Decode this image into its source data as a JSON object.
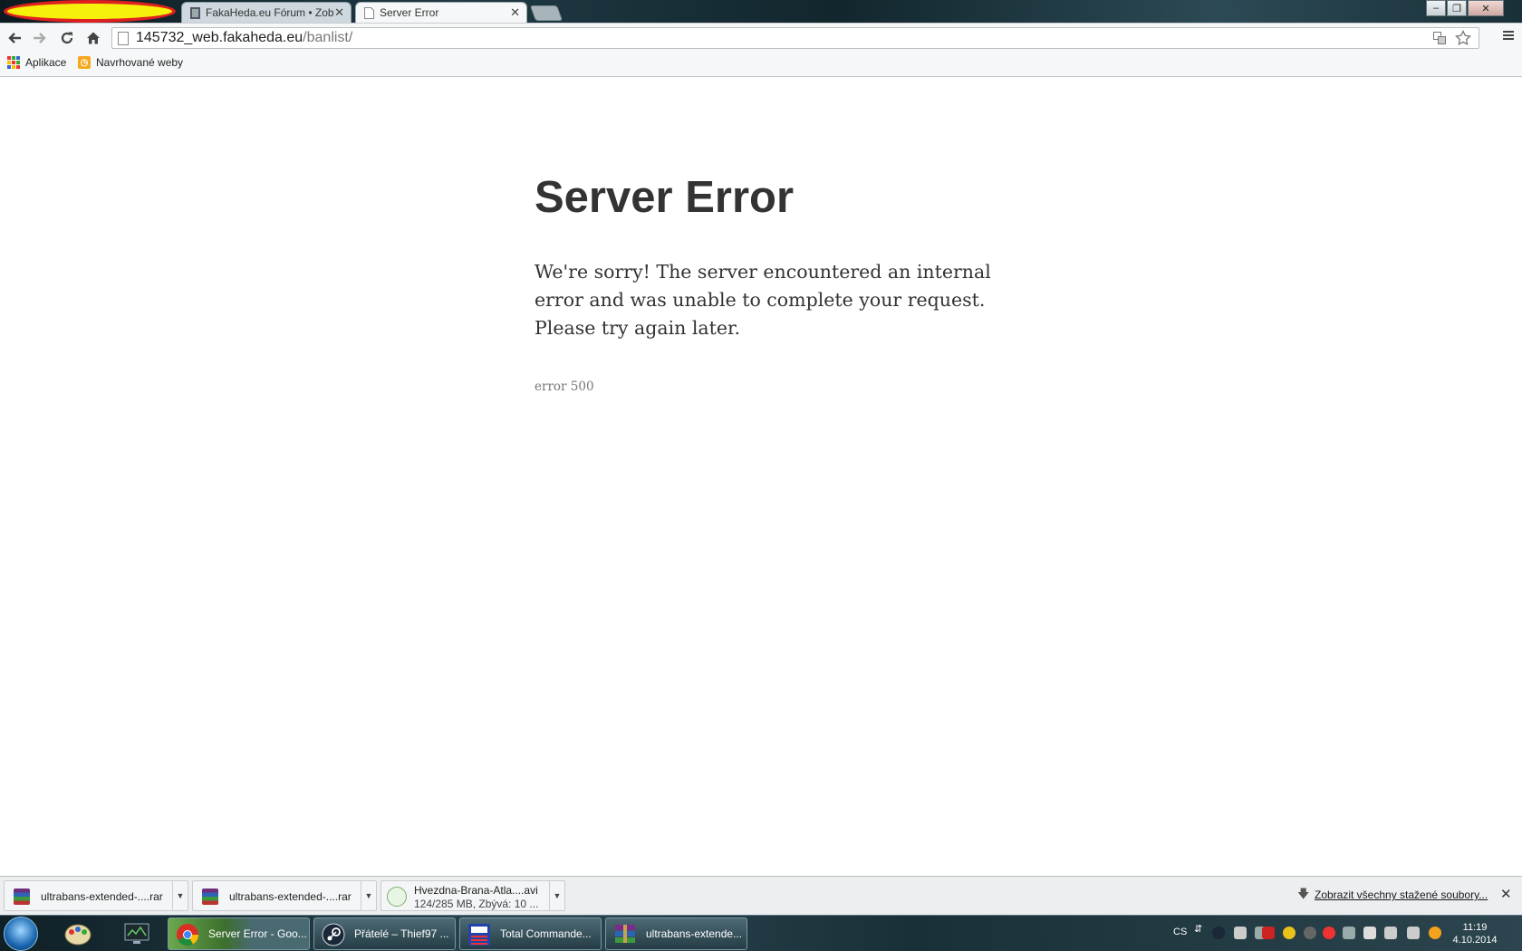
{
  "tabs": [
    {
      "title": "FakaHeda.eu Fórum • Zob",
      "active": false
    },
    {
      "title": "Server Error",
      "active": true
    }
  ],
  "window_controls": {
    "minimize": "‒",
    "restore": "❐",
    "close": "✕"
  },
  "address_bar": {
    "domain": "145732_web.fakaheda.eu",
    "path": "/banlist/"
  },
  "bookmarks": [
    {
      "label": "Aplikace",
      "icon": "apps-grid-icon"
    },
    {
      "label": "Navrhované weby",
      "icon": "suggested-sites-icon"
    }
  ],
  "page": {
    "title": "Server Error",
    "message": "We're sorry! The server encountered an internal error and was unable to complete your request. Please try again later.",
    "code": "error 500"
  },
  "downloads": {
    "items": [
      {
        "name": "ultrabans-extended-....rar"
      },
      {
        "name": "ultrabans-extended-....rar"
      },
      {
        "name": "Hvezdna-Brana-Atla....avi",
        "status": "124/285 MB, Zbývá: 10 ..."
      }
    ],
    "show_all": "Zobrazit všechny stažené soubory...",
    "close": "✕"
  },
  "taskbar": {
    "tasks": [
      {
        "label": "Server Error - Goo...",
        "icon": "chrome-icon",
        "active": true
      },
      {
        "label": "Přátelé – Thief97 ...",
        "icon": "steam-icon",
        "active": false
      },
      {
        "label": "Total Commande...",
        "icon": "total-commander-icon",
        "active": false
      },
      {
        "label": "ultrabans-extende...",
        "icon": "winrar-icon",
        "active": false
      }
    ],
    "language": "CS",
    "time": "11:19",
    "date": "4.10.2014"
  },
  "colors": {
    "highlight_fill": "#f6f10a",
    "highlight_border": "#e02020",
    "title_text": "#333333",
    "code_text": "#777777"
  }
}
